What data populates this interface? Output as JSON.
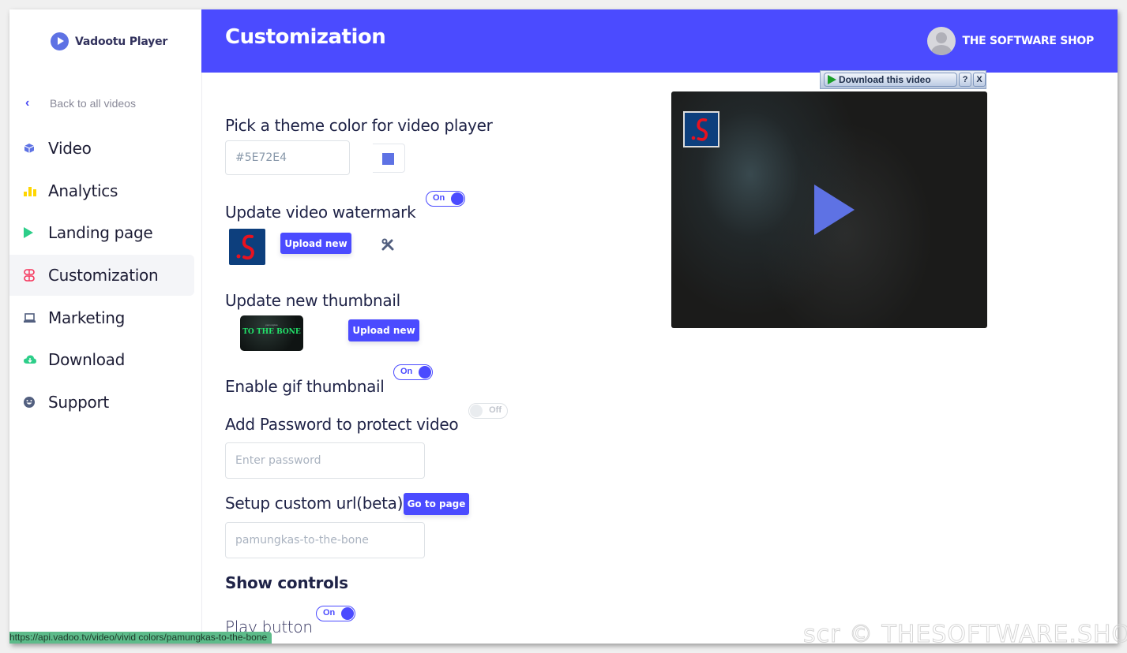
{
  "app": {
    "name": "Vadootu Player"
  },
  "sidebar": {
    "back_label": "Back to all videos",
    "items": [
      {
        "label": "Video",
        "icon": "cube-icon",
        "color": "#5e72e4"
      },
      {
        "label": "Analytics",
        "icon": "bar-chart-icon",
        "color": "#ffd600"
      },
      {
        "label": "Landing page",
        "icon": "play-icon",
        "color": "#2dce89"
      },
      {
        "label": "Customization",
        "icon": "customize-icon",
        "color": "#f5365c",
        "active": true
      },
      {
        "label": "Marketing",
        "icon": "laptop-icon",
        "color": "#525f7f"
      },
      {
        "label": "Download",
        "icon": "cloud-download-icon",
        "color": "#2dce89"
      },
      {
        "label": "Support",
        "icon": "smile-icon",
        "color": "#525f7f"
      }
    ]
  },
  "header": {
    "title": "Customization",
    "user_name": "THE SOFTWARE SHOP",
    "accent": "#4b4bff"
  },
  "download_bar": {
    "label": "Download this video",
    "help": "?",
    "close": "X"
  },
  "settings": {
    "theme_color": {
      "title": "Pick a theme color for video player",
      "value": "#5E72E4",
      "swatch": "#5e72e4"
    },
    "watermark": {
      "title": "Update video watermark",
      "toggle": "On",
      "upload_label": "Upload new"
    },
    "thumbnail": {
      "title": "Update new thumbnail",
      "thumb_text": "TO THE BONE",
      "upload_label": "Upload new"
    },
    "gif_thumbnail": {
      "title": "Enable gif thumbnail",
      "toggle": "On"
    },
    "password": {
      "title": "Add Password to protect video",
      "toggle": "Off",
      "placeholder": "Enter password"
    },
    "custom_url": {
      "title": "Setup custom url(beta)",
      "button": "Go to page",
      "placeholder": "pamungkas-to-the-bone"
    },
    "controls": {
      "title": "Show controls",
      "play_button_label": "Play button",
      "play_button_toggle": "On"
    }
  },
  "status_bar": {
    "url": "https://api.vadoo.tv/video/vivid colors/pamungkas-to-the-bone"
  },
  "screenshot_watermark": "scr © THESOFTWARE.SHOP"
}
